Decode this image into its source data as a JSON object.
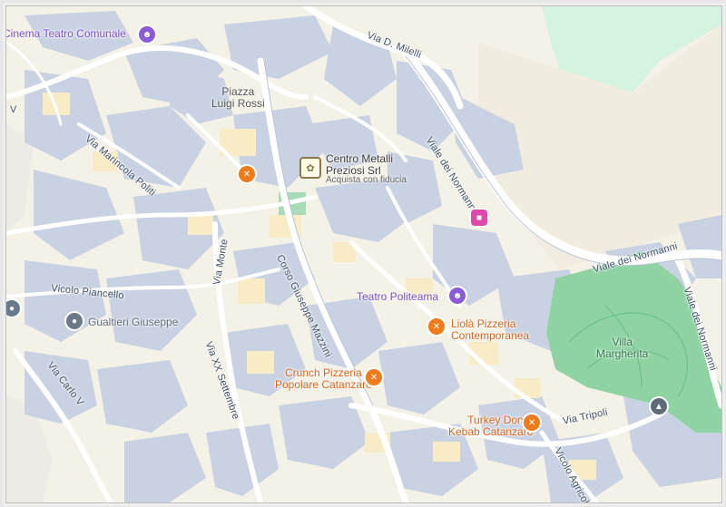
{
  "map": {
    "streets": {
      "via_d_milelli": "Via D. Milelli",
      "viale_dei_normanni_a": "Viale dei Normanni",
      "viale_dei_normanni_b": "Viale dei Normanni",
      "viale_dei_normanni_c": "Viale dei Normanni",
      "via_marincola_politi": "Via Marincola Politi",
      "via_monte": "Via Monte",
      "corso_giuseppe_mazzini": "Corso Giuseppe Mazzini",
      "vicolo_piancello": "Vicolo Piancello",
      "via_xx_settembre": "Via XX Settembre",
      "via_carlo_v": "Via Carlo V",
      "via_tripoli": "Via Tripoli",
      "vicolo_agricolo": "Vicolo Agricolo",
      "via_left_edge": "V"
    },
    "places": {
      "piazza_luigi_rossi": [
        "Piazza",
        "Luigi Rossi"
      ],
      "villa_margherita": [
        "Villa",
        "Margherita"
      ]
    },
    "pois": {
      "cinema_teatro_comunale": "Cinema Teatro Comunale",
      "centro_metalli_name": [
        "Centro Metalli",
        "Preziosi Srl"
      ],
      "centro_metalli_sub": "Acquista con fiducia",
      "teatro_politeama": "Teatro Politeama",
      "liola_pizzeria": [
        "Liolà Pizzeria",
        "Contemporanea"
      ],
      "crunch_pizzeria": [
        "Crunch Pizzeria",
        "Popolare Catanzaro"
      ],
      "turkey_doner": [
        "Turkey Doner",
        "Kebab Catanzaro"
      ],
      "gualtieri_giuseppe": "Gualtieri Giuseppe"
    },
    "icons": {
      "restaurant": "fork-knife-icon",
      "theater": "theater-masks-icon",
      "hotel": "bed-icon",
      "school": "graduation-cap-icon",
      "place": "place-pin-icon",
      "shop": "shop-logo-icon"
    },
    "colors": {
      "background": "#f4f1e6",
      "blocks": "#c9d2e2",
      "roads": "#ffffff",
      "park": "#8fd3a3",
      "poi_orange": "#ef7b1c",
      "poi_purple": "#8b5cd6",
      "poi_pink": "#e04aa8"
    }
  }
}
